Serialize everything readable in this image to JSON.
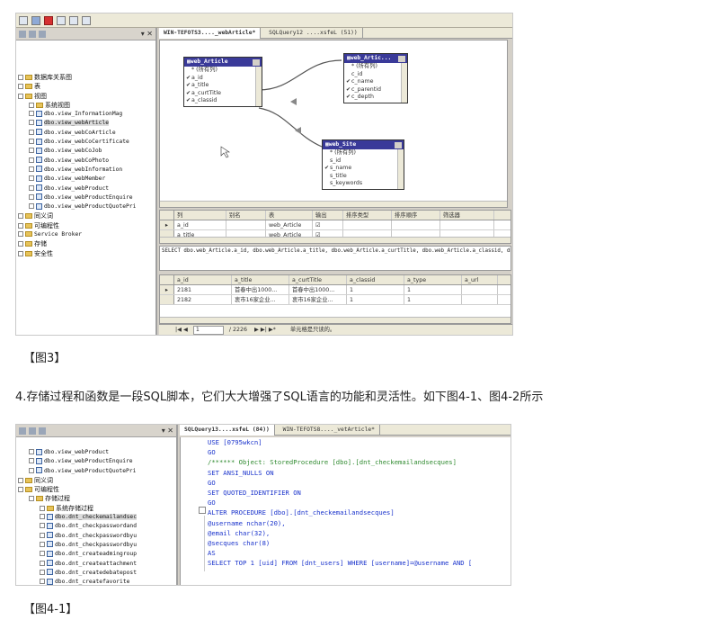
{
  "figure1": {
    "caption": "【图3】",
    "explorer": {
      "items": [
        {
          "type": "folder",
          "label": "数据库关系图",
          "indent": 0,
          "cjk": true
        },
        {
          "type": "folder",
          "label": "表",
          "indent": 0,
          "cjk": true
        },
        {
          "type": "folder",
          "label": "视图",
          "indent": 0,
          "cjk": true,
          "open": true
        },
        {
          "type": "folder",
          "label": "系统视图",
          "indent": 1,
          "cjk": true
        },
        {
          "type": "view",
          "label": "dbo.view_InformationMag",
          "indent": 1
        },
        {
          "type": "view",
          "label": "dbo.view_webArticle",
          "indent": 1,
          "highlight": true
        },
        {
          "type": "view",
          "label": "dbo.view_webCoArticle",
          "indent": 1
        },
        {
          "type": "view",
          "label": "dbo.view_webCoCertificate",
          "indent": 1
        },
        {
          "type": "view",
          "label": "dbo.view_webCoJob",
          "indent": 1
        },
        {
          "type": "view",
          "label": "dbo.view_webCoPhoto",
          "indent": 1
        },
        {
          "type": "view",
          "label": "dbo.view_webInformation",
          "indent": 1
        },
        {
          "type": "view",
          "label": "dbo.view_webMember",
          "indent": 1
        },
        {
          "type": "view",
          "label": "dbo.view_webProduct",
          "indent": 1
        },
        {
          "type": "view",
          "label": "dbo.view_webProductEnquire",
          "indent": 1
        },
        {
          "type": "view",
          "label": "dbo.view_webProductQuotePri",
          "indent": 1
        },
        {
          "type": "folder",
          "label": "同义词",
          "indent": 0,
          "cjk": true
        },
        {
          "type": "folder",
          "label": "可编程性",
          "indent": 0,
          "cjk": true
        },
        {
          "type": "folder",
          "label": "Service Broker",
          "indent": 0
        },
        {
          "type": "folder",
          "label": "存储",
          "indent": 0,
          "cjk": true
        },
        {
          "type": "folder",
          "label": "安全性",
          "indent": 0,
          "cjk": true
        }
      ]
    },
    "tabs": [
      "WIN-TEFOTS3...._webArticle*",
      "SQLQuery12 ....xsfeL (51))"
    ],
    "tables": {
      "web_article": {
        "title": "web_Article",
        "rows": [
          {
            "label": "* (所有列)",
            "checked": false
          },
          {
            "label": "a_id",
            "checked": true
          },
          {
            "label": "a_title",
            "checked": true
          },
          {
            "label": "a_curtTitle",
            "checked": true
          },
          {
            "label": "a_classid",
            "checked": true
          }
        ]
      },
      "web_article2": {
        "title": "web_Artic...",
        "rows": [
          {
            "label": "* (所有列)",
            "checked": false
          },
          {
            "label": "c_id",
            "checked": false
          },
          {
            "label": "c_name",
            "checked": true
          },
          {
            "label": "c_parentid",
            "checked": true
          },
          {
            "label": "c_depth",
            "checked": true
          }
        ]
      },
      "web_site": {
        "title": "web_Site",
        "rows": [
          {
            "label": "* (所有列)",
            "checked": false
          },
          {
            "label": "s_id",
            "checked": false
          },
          {
            "label": "s_name",
            "checked": true
          },
          {
            "label": "s_title",
            "checked": false
          },
          {
            "label": "s_keywords",
            "checked": false
          }
        ]
      }
    },
    "criteria": {
      "headers": [
        "列",
        "别名",
        "表",
        "输出",
        "排序类型",
        "排序顺序",
        "筛选器"
      ],
      "rows": [
        [
          "a_id",
          "",
          "web_Article",
          "☑",
          "",
          "",
          ""
        ],
        [
          "a_title",
          "",
          "web_Article",
          "☑",
          "",
          "",
          ""
        ]
      ]
    },
    "sql": "SELECT   dbo.web_Article.a_id, dbo.web_Article.a_title, dbo.web_Article.a_curtTitle, dbo.web_Article.a_classid, dbo.web_",
    "results": {
      "headers": [
        "a_id",
        "a_title",
        "a_curtTitle",
        "a_classid",
        "a_type",
        "a_url"
      ],
      "rows": [
        [
          "2181",
          "首春中出1000...",
          "首春中出1000...",
          "1",
          "1",
          ""
        ],
        [
          "2182",
          "衷市16家企业...",
          "衷市16家企业...",
          "1",
          "1",
          ""
        ]
      ]
    },
    "status": {
      "page": "1",
      "total": "/ 2226",
      "note": "单元格是只读的。"
    }
  },
  "paragraph": "4.存储过程和函数是一段SQL脚本，它们大大增强了SQL语言的功能和灵活性。如下图4-1、图4-2所示",
  "figure2": {
    "caption": "【图4-1】",
    "explorer": {
      "items": [
        {
          "type": "view",
          "label": "dbo.view_webProduct",
          "indent": 1
        },
        {
          "type": "view",
          "label": "dbo.view_webProductEnquire",
          "indent": 1
        },
        {
          "type": "view",
          "label": "dbo.view_webProductQuotePri",
          "indent": 1
        },
        {
          "type": "folder",
          "label": "同义词",
          "indent": 0,
          "cjk": true
        },
        {
          "type": "folder",
          "label": "可编程性",
          "indent": 0,
          "cjk": true,
          "open": true
        },
        {
          "type": "folder",
          "label": "存储过程",
          "indent": 1,
          "cjk": true,
          "open": true
        },
        {
          "type": "folder",
          "label": "系统存储过程",
          "indent": 2,
          "cjk": true
        },
        {
          "type": "proc",
          "label": "dbo.dnt_checkemailandsec",
          "indent": 2,
          "highlight": true
        },
        {
          "type": "proc",
          "label": "dbo.dnt_checkpasswordand",
          "indent": 2
        },
        {
          "type": "proc",
          "label": "dbo.dnt_checkpasswordbyu",
          "indent": 2
        },
        {
          "type": "proc",
          "label": "dbo.dnt_checkpasswordbyu",
          "indent": 2
        },
        {
          "type": "proc",
          "label": "dbo.dnt_createadmingroup",
          "indent": 2
        },
        {
          "type": "proc",
          "label": "dbo.dnt_createattachment",
          "indent": 2
        },
        {
          "type": "proc",
          "label": "dbo.dnt_createdebatepost",
          "indent": 2
        },
        {
          "type": "proc",
          "label": "dbo.dnt_createfavorite",
          "indent": 2
        }
      ]
    },
    "tabs": [
      "SQLQuery13....xsfeL (84))",
      "WIN-TEFOTS8...._vetArticle*"
    ],
    "code": [
      {
        "text": "USE [0795wkcn]",
        "kind": "kw"
      },
      {
        "text": "GO",
        "kind": "kw"
      },
      {
        "text": "/****** Object:  StoredProcedure [dbo].[dnt_checkemailandsecques]",
        "kind": "cmt"
      },
      {
        "text": "SET ANSI_NULLS ON",
        "kind": "kw"
      },
      {
        "text": "GO",
        "kind": "kw"
      },
      {
        "text": "SET QUOTED_IDENTIFIER ON",
        "kind": "kw"
      },
      {
        "text": "GO",
        "kind": "kw"
      },
      {
        "text": "ALTER PROCEDURE [dbo].[dnt_checkemailandsecques]",
        "kind": "kw"
      },
      {
        "text": "@username nchar(20),",
        "kind": "kw"
      },
      {
        "text": "@email char(32),",
        "kind": "kw"
      },
      {
        "text": "@secques char(8)",
        "kind": "kw"
      },
      {
        "text": "AS",
        "kind": "kw"
      },
      {
        "text": "SELECT TOP 1 [uid] FROM [dnt_users] WHERE [username]=@username AND [",
        "kind": "kw"
      }
    ]
  }
}
